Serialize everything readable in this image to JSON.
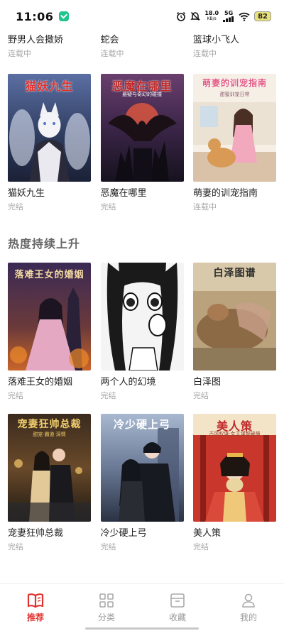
{
  "status_bar": {
    "time": "11:06",
    "net_speed": "18.0",
    "net_unit": "KB/s",
    "network": "5G",
    "battery": "82"
  },
  "top_row": [
    {
      "title": "野男人会撒娇",
      "status": "连载中"
    },
    {
      "title": "蛇会",
      "status": "连载中"
    },
    {
      "title": "篮球小飞人",
      "status": "连载中"
    }
  ],
  "row1": [
    {
      "title": "猫妖九生",
      "status": "完结",
      "cover_text": "猫妖九生",
      "cover_sub": ""
    },
    {
      "title": "恶魔在哪里",
      "status": "完结",
      "cover_text": "恶魔在哪里",
      "cover_sub": "悬疑与奇幻的碰撞"
    },
    {
      "title": "萌妻的训宠指南",
      "status": "连载中",
      "cover_text": "萌妻的训宠指南",
      "cover_sub": "甜蜜训宠日常"
    }
  ],
  "section": {
    "title": "热度持续上升"
  },
  "row2": [
    {
      "title": "落难王女的婚姻",
      "status": "完结",
      "cover_text": "落难王女的婚姻"
    },
    {
      "title": "两个人的幻境",
      "status": "完结",
      "cover_text": ""
    },
    {
      "title": "白泽图",
      "status": "完结",
      "cover_text": "白泽图谱"
    }
  ],
  "row3": [
    {
      "title": "宠妻狂帅总裁",
      "status": "完结",
      "cover_text": "宠妻狂帅总裁",
      "cover_sub": "甜宠·霸道·深情"
    },
    {
      "title": "冷少硬上弓",
      "status": "完结",
      "cover_text": "冷少硬上弓"
    },
    {
      "title": "美人策",
      "status": "完结",
      "cover_text": "美人策",
      "cover_sub": "古风权谋·女主谋智破局"
    }
  ],
  "nav": {
    "items": [
      {
        "label": "推荐",
        "icon": "book-open-icon",
        "active": true
      },
      {
        "label": "分类",
        "icon": "grid-icon",
        "active": false
      },
      {
        "label": "收藏",
        "icon": "archive-box-icon",
        "active": false
      },
      {
        "label": "我的",
        "icon": "user-icon",
        "active": false
      }
    ],
    "active_color": "#e0312e",
    "inactive_color": "#999999"
  }
}
